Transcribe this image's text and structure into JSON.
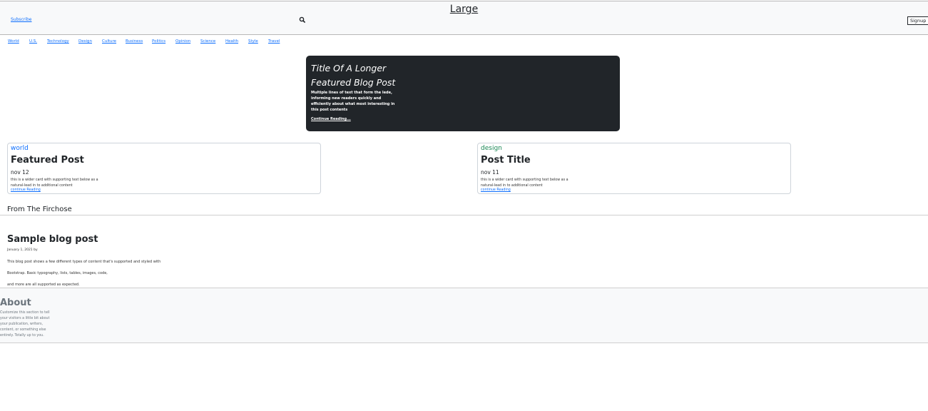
{
  "header": {
    "subscribe": "Subscribe",
    "brand": "Large",
    "search_icon": "search-icon",
    "signup": "Signup"
  },
  "nav": [
    "World",
    "U.S.",
    "Technology",
    "Design",
    "Culture",
    "Business",
    "Politics",
    "Opinion",
    "Science",
    "Health",
    "Style",
    "Travel"
  ],
  "hero": {
    "title": "Title Of A Longer Featured Blog Post",
    "lede": "Multiple lines of text that form the lede, informing new readers quickly and efficiently about what most interesting in this post contents",
    "link": "Continue Reading..."
  },
  "cards": [
    {
      "category": "world",
      "category_color": "#0d6efd",
      "title": "Featured Post",
      "date": "nov 12",
      "text": "this is a wider card with supporting text below as a natural-lead in to additional content",
      "link": "continue Reading"
    },
    {
      "category": "design",
      "category_color": "#198754",
      "title": "Post Title",
      "date": "nov 11",
      "text": "this is a wider card with supporting text below as a natural-lead in to additional content",
      "link": "continue Reading"
    }
  ],
  "section": {
    "title": "From The Firchose"
  },
  "post": {
    "title": "Sample blog post",
    "meta": "January 1, 2021 by",
    "lines": [
      "This blog post shows a few different types of content that's supported and styled with",
      "Bootstrap. Basic typography, lists, tables, images, code,",
      "and more are all supported as expected."
    ]
  },
  "about": {
    "title": "About",
    "text": "Customize this section to tell your visitors a little bit about your publication, writers, content, or something else entirely. Totally up to you."
  }
}
